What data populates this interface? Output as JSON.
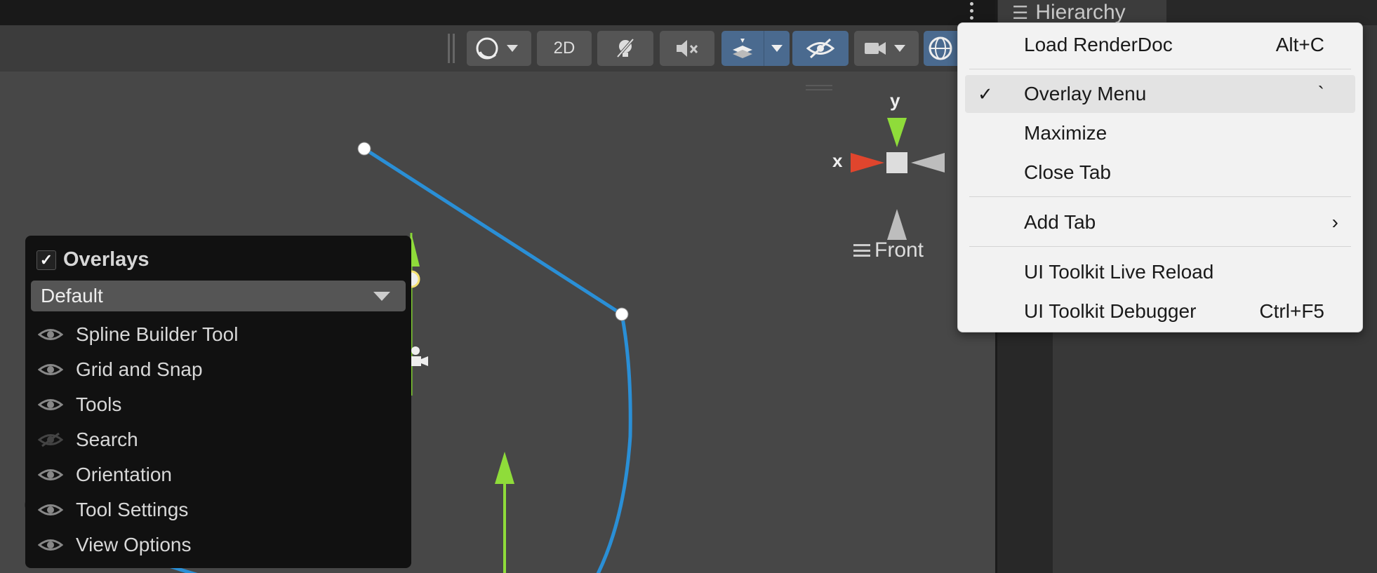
{
  "hierarchy_tab": {
    "label": "Hierarchy",
    "icon": "list-tree-icon"
  },
  "toolbar": {
    "shading_icon": "sphere-icon",
    "mode_2d": "2D",
    "lighting_icon": "light-off-icon",
    "audio_icon": "mute-icon",
    "effects_icon": "layers-icon",
    "visibility_icon": "hidden-eye-icon",
    "camera_icon": "camera-icon",
    "gizmos_icon": "gizmo-globe-icon"
  },
  "overlays_panel": {
    "title": "Overlays",
    "checked": true,
    "preset": "Default",
    "items": [
      {
        "label": "Spline Builder Tool",
        "visible": true
      },
      {
        "label": "Grid and Snap",
        "visible": true
      },
      {
        "label": "Tools",
        "visible": true
      },
      {
        "label": "Search",
        "visible": false
      },
      {
        "label": "Orientation",
        "visible": true
      },
      {
        "label": "Tool Settings",
        "visible": true
      },
      {
        "label": "View Options",
        "visible": true
      }
    ]
  },
  "orientation_gizmo": {
    "x_label": "x",
    "y_label": "y",
    "view_label": "Front"
  },
  "context_menu": {
    "items": [
      {
        "label": "Load RenderDoc",
        "shortcut": "Alt+C"
      },
      {
        "label": "Overlay Menu",
        "shortcut": "`",
        "checked": true
      },
      {
        "label": "Maximize",
        "shortcut": ""
      },
      {
        "label": "Close Tab",
        "shortcut": ""
      },
      {
        "label": "Add Tab",
        "shortcut": "›"
      },
      {
        "label": "UI Toolkit Live Reload",
        "shortcut": ""
      },
      {
        "label": "UI Toolkit Debugger",
        "shortcut": "Ctrl+F5"
      }
    ]
  },
  "colors": {
    "spline": "#2a8fd6",
    "axis_y": "#8fdc3a",
    "axis_x": "#e0452d",
    "toolbar_active": "#4a6a8f"
  }
}
